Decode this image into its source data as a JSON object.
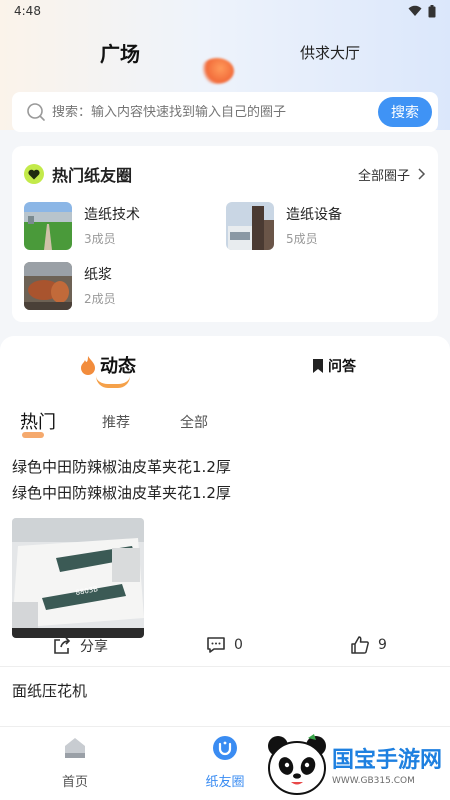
{
  "status_bar": {
    "time": "4:48"
  },
  "header": {
    "title": "广场",
    "secondary_tab": "供求大厅"
  },
  "search": {
    "placeholder": "搜索：输入内容快速找到输入自己的圈子",
    "button_label": "搜索"
  },
  "hot_circles": {
    "title": "热门纸友圈",
    "view_all": "全部圈子",
    "items": [
      {
        "name": "造纸技术",
        "members": "3成员",
        "icon": "paper-tech-thumb"
      },
      {
        "name": "造纸设备",
        "members": "5成员",
        "icon": "paper-equipment-thumb"
      },
      {
        "name": "纸浆",
        "members": "2成员",
        "icon": "pulp-thumb"
      }
    ]
  },
  "feed": {
    "tabs": {
      "dynamic": "动态",
      "qa": "问答"
    },
    "subtabs": [
      "热门",
      "推荐",
      "全部"
    ],
    "posts": [
      {
        "lines": [
          "绿色中田防辣椒油皮革夹花1.2厚",
          "绿色中田防辣椒油皮革夹花1.2厚"
        ],
        "image": "table-mat-photo",
        "image_label": "8803B",
        "share_label": "分享",
        "comments": "0",
        "likes": "9"
      },
      {
        "title": "面纸压花机"
      }
    ]
  },
  "bottom_nav": [
    {
      "label": "首页",
      "icon": "home-icon"
    },
    {
      "label": "纸友圈",
      "icon": "paper-circle-icon"
    }
  ],
  "watermark": {
    "text": "国宝手游网",
    "url": "WWW.GB315.COM"
  },
  "colors": {
    "accent": "#3f93f5",
    "orange": "#f28c3c",
    "member_gray": "#999999"
  }
}
